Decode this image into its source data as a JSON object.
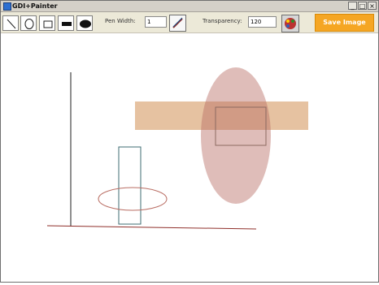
{
  "window": {
    "title": "GDI+Painter",
    "minimize_label": "_",
    "maximize_label": "□",
    "close_label": "×"
  },
  "toolbar": {
    "pen_width_label": "Pen Width:",
    "pen_width_value": "1",
    "transparency_label": "Transparency:",
    "transparency_value": "120",
    "save_label": "Save Image"
  },
  "tools": [
    "line-tool",
    "ellipse-outline-tool",
    "rectangle-outline-tool",
    "rectangle-fill-tool",
    "ellipse-fill-tool"
  ],
  "colors": {
    "accent": "#f5a623",
    "shape_orange": "#d9a16f",
    "shape_rose": "#b96d63",
    "line_dark": "#1f1f1f",
    "line_red": "#8f2f2a",
    "line_teal": "#3f6e73"
  }
}
